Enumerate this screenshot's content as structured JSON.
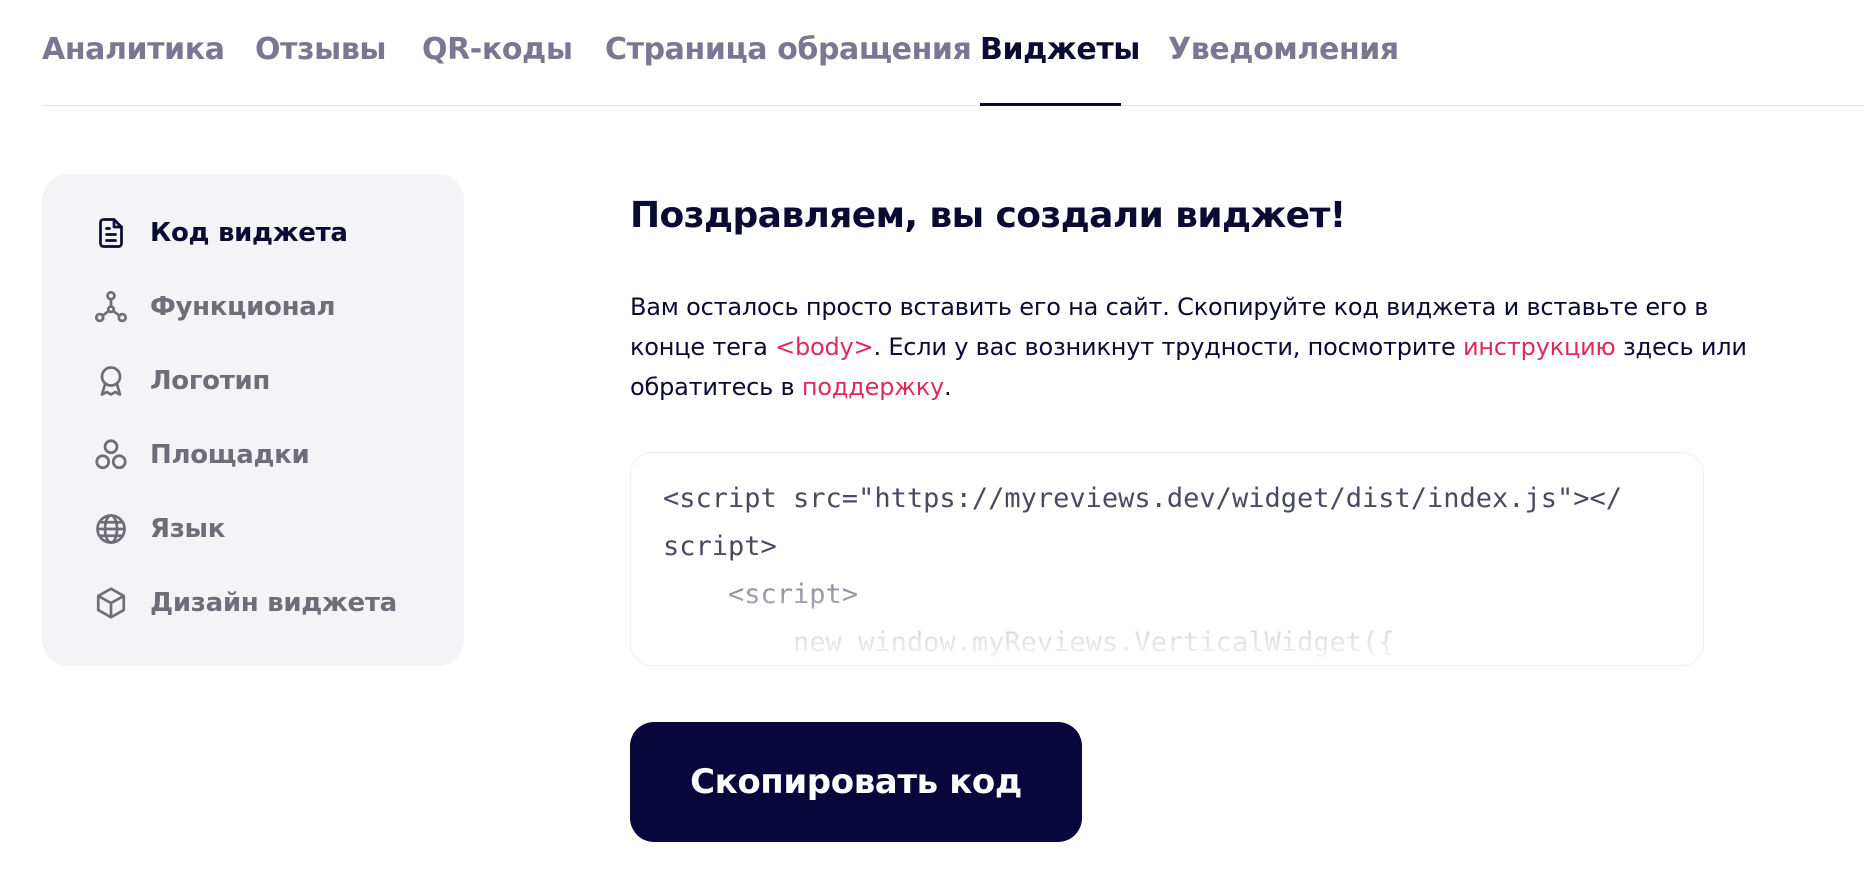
{
  "tabs": [
    {
      "label": "Аналитика"
    },
    {
      "label": "Отзывы"
    },
    {
      "label": "QR-коды"
    },
    {
      "label": "Страница обращения"
    },
    {
      "label": "Виджеты",
      "active": true
    },
    {
      "label": "Уведомления"
    }
  ],
  "sidebar": {
    "items": [
      {
        "label": "Код виджета",
        "icon": "file-text-icon",
        "active": true
      },
      {
        "label": "Функционал",
        "icon": "nodes-icon"
      },
      {
        "label": "Логотип",
        "icon": "award-icon"
      },
      {
        "label": "Площадки",
        "icon": "circles-icon"
      },
      {
        "label": "Язык",
        "icon": "globe-icon"
      },
      {
        "label": "Дизайн виджета",
        "icon": "box-icon"
      }
    ]
  },
  "main": {
    "title": "Поздравляем, вы создали виджет!",
    "desc": {
      "p1": "Вам осталось просто вставить его на сайт. Скопируйте код виджета и вставьте его в конце тега ",
      "body_tag": "<body>",
      "p2": ". Если у вас возникнут трудности, посмотрите ",
      "link_instruction": "инструкцию",
      "p3": " здесь или обратитесь в ",
      "link_support": "поддержку",
      "p4": "."
    },
    "code_lines": [
      "<script src=\"https://myreviews.dev/widget/dist/index.js\"></",
      "script>",
      "    <script>",
      "        new window.myReviews.VerticalWidget({"
    ],
    "copy_button": "Скопировать код"
  },
  "colors": {
    "primary": "#0b0a33",
    "accent_link": "#e02b5a",
    "tab_inactive": "#7a7793",
    "sidebar_bg": "#f4f4f6",
    "button_bg": "#08063a"
  }
}
